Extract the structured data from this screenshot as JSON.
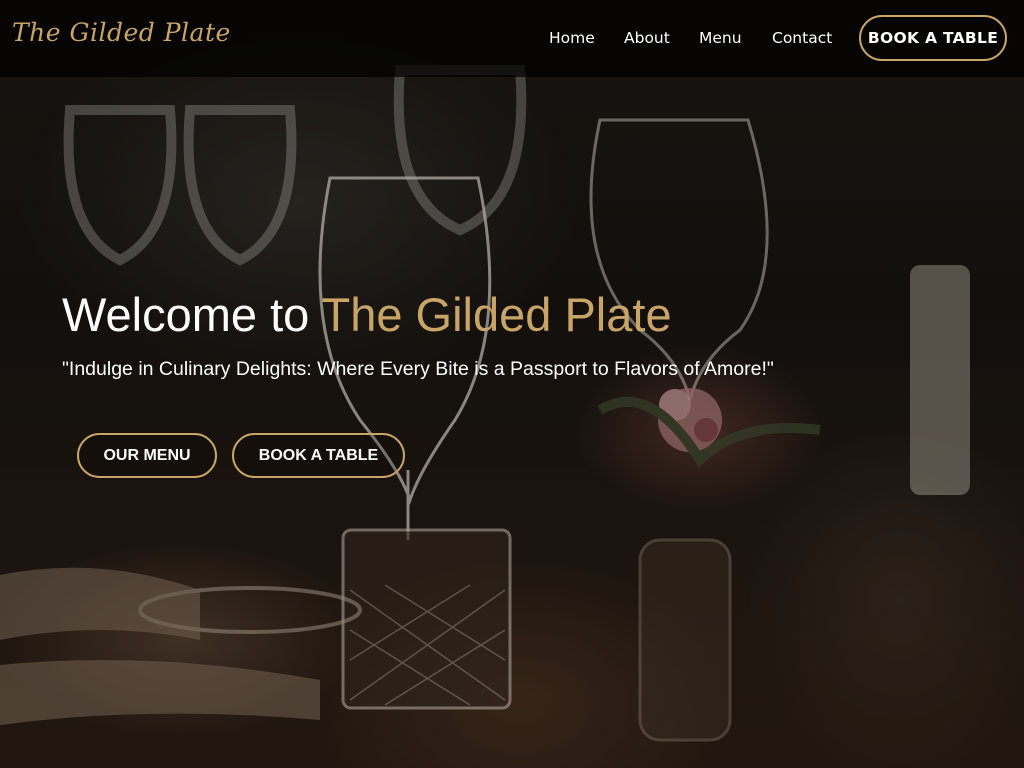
{
  "brand": {
    "name": "The Gilded Plate"
  },
  "nav": {
    "items": [
      {
        "label": "Home"
      },
      {
        "label": "About"
      },
      {
        "label": "Menu"
      },
      {
        "label": "Contact"
      }
    ],
    "cta_label": "BOOK A TABLE"
  },
  "hero": {
    "title_prefix": "Welcome to ",
    "title_accent": "The Gilded Plate",
    "tagline": "\"Indulge in Culinary Delights: Where Every Bite is a Passport to Flavors of Amore!\"",
    "buttons": [
      {
        "label": "OUR MENU"
      },
      {
        "label": "BOOK A TABLE"
      }
    ]
  },
  "colors": {
    "accent": "#c9a467",
    "header_bg": "#000000",
    "text": "#ffffff"
  },
  "icons": {
    "background": "restaurant-table-photo"
  }
}
